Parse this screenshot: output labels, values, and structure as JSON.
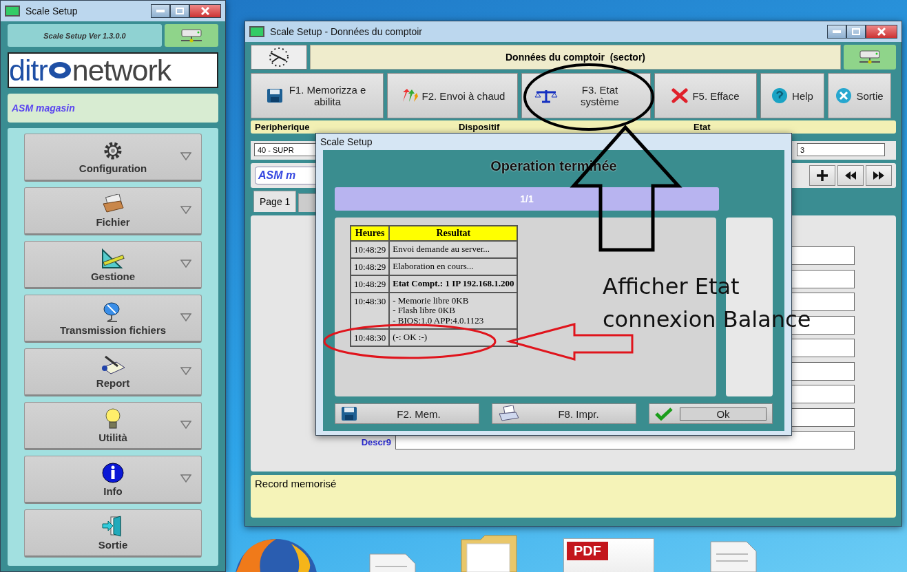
{
  "desktop": {
    "icons": [
      {
        "kind": "firefox"
      },
      {
        "kind": "document"
      },
      {
        "kind": "folder"
      },
      {
        "kind": "pdf",
        "label": "PDF"
      },
      {
        "kind": "document"
      }
    ]
  },
  "launcher": {
    "title": "Scale Setup",
    "version": "Scale Setup Ver 1.3.0.0",
    "logo": {
      "before": "ditr",
      "after": "network"
    },
    "store": "ASM magasin",
    "menu": [
      {
        "kind": "gear",
        "label": "Configuration",
        "expandable": true
      },
      {
        "kind": "box",
        "label": "Fichier",
        "expandable": true
      },
      {
        "kind": "tools",
        "label": "Gestione",
        "expandable": true
      },
      {
        "kind": "dish",
        "label": "Transmission fichiers",
        "expandable": true
      },
      {
        "kind": "notepad",
        "label": "Report",
        "expandable": true
      },
      {
        "kind": "bulb",
        "label": "Utilità",
        "expandable": true
      },
      {
        "kind": "info",
        "label": "Info",
        "expandable": true
      },
      {
        "kind": "exit",
        "label": "Sortie",
        "expandable": false
      }
    ]
  },
  "main_window": {
    "title": "Scale Setup - Données du comptoir",
    "header": "Données du comptoir  (sector)",
    "toolbar": [
      {
        "kind": "save",
        "label": "F1. Memorizza e abilita"
      },
      {
        "kind": "send",
        "label": "F2. Envoi à chaud"
      },
      {
        "kind": "scale",
        "label": "F3. Etat système"
      },
      {
        "kind": "delete",
        "label": "F5. Efface"
      },
      {
        "kind": "help",
        "label": "Help"
      },
      {
        "kind": "exit",
        "label": "Sortie"
      }
    ],
    "columns": [
      "Peripherique",
      "Dispositif",
      "Etat"
    ],
    "device_field": {
      "value": "40 - SUPR"
    },
    "device_field_2": {
      "value": "3"
    },
    "record_field": {
      "value": "ASM m"
    },
    "tabs": [
      {
        "label": "Page 1",
        "selected": true
      },
      {
        "selected": false
      }
    ],
    "form": {
      "label": "Descr9"
    },
    "status": "Record memorisé"
  },
  "dialog": {
    "title": "Scale Setup",
    "heading": "Operation terminée",
    "page": "1/1",
    "columns": [
      "Heures",
      "Resultat"
    ],
    "rows": [
      {
        "time": "10:48:29",
        "result": [
          "Envoi demande au server..."
        ],
        "bold": false
      },
      {
        "time": "10:48:29",
        "result": [
          "Elaboration en cours..."
        ],
        "bold": false
      },
      {
        "time": "10:48:29",
        "result": [
          "Etat Compt.: 1 IP 192.168.1.200"
        ],
        "bold": true
      },
      {
        "time": "10:48:30",
        "result": [
          "- Memorie libre 0KB",
          "- Flash libre 0KB",
          "- BIOS:1.0 APP:4.0.1123"
        ],
        "bold": false
      },
      {
        "time": "10:48:30",
        "result": [
          "(-: OK :-)"
        ],
        "bold": false
      }
    ],
    "buttons": [
      {
        "kind": "save",
        "label": "F2. Mem."
      },
      {
        "kind": "print",
        "label": "F8. Impr."
      },
      {
        "kind": "check",
        "label": "Ok"
      }
    ]
  },
  "annotation": {
    "lines": [
      "Afficher Etat",
      "connexion Balance"
    ]
  }
}
